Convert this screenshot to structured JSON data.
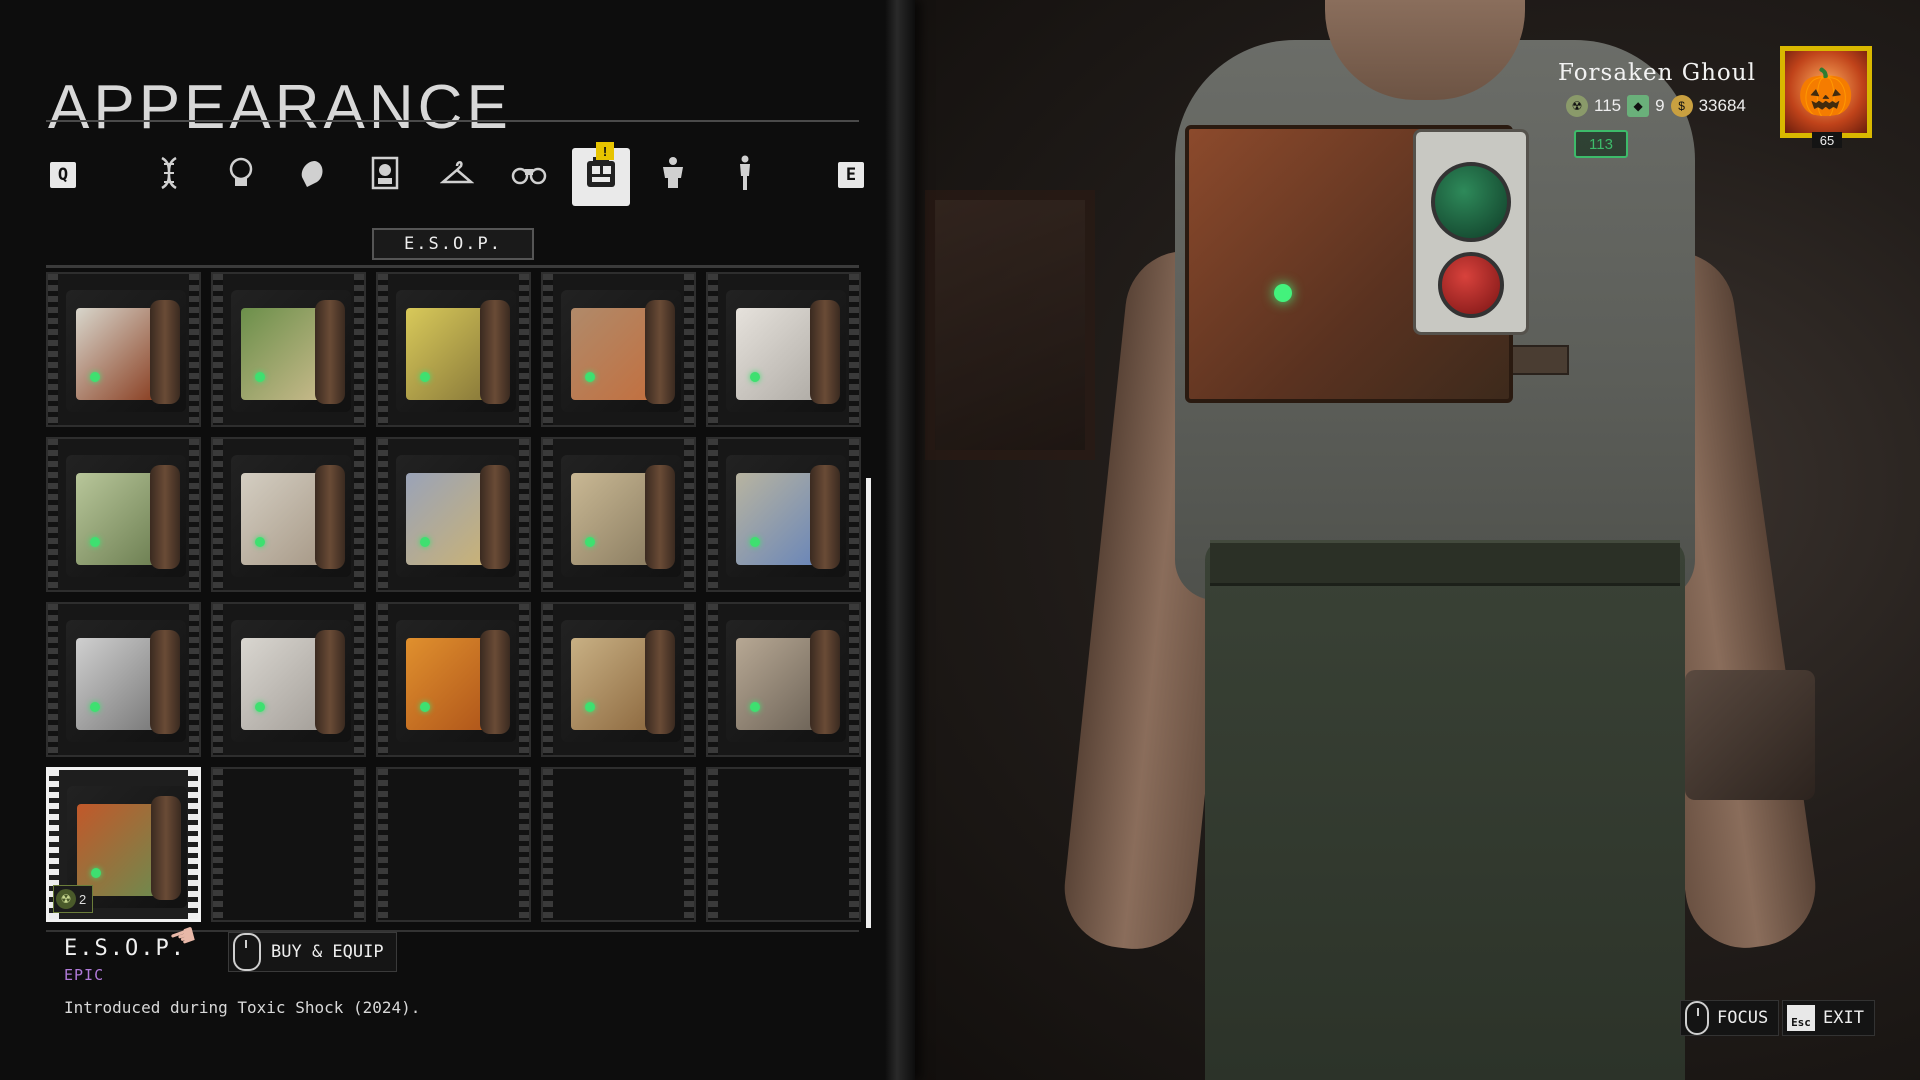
{
  "page": {
    "title": "APPEARANCE"
  },
  "tabs": {
    "prev_key": "Q",
    "next_key": "E",
    "items": [
      {
        "icon": "dna-icon"
      },
      {
        "icon": "head-icon"
      },
      {
        "icon": "profile-icon"
      },
      {
        "icon": "portrait-icon"
      },
      {
        "icon": "hanger-icon"
      },
      {
        "icon": "binoculars-icon"
      },
      {
        "icon": "backpack-icon",
        "active": true
      },
      {
        "icon": "torso-icon",
        "notification": "!"
      },
      {
        "icon": "body-icon"
      }
    ]
  },
  "category": {
    "label": "E.S.O.P."
  },
  "grid": {
    "items": [
      {
        "colors": [
          "#d8d6cc",
          "#8a3f22"
        ]
      },
      {
        "colors": [
          "#6b8f4a",
          "#c7b98a"
        ]
      },
      {
        "colors": [
          "#d8c95a",
          "#8a7a3a"
        ]
      },
      {
        "colors": [
          "#b08a6a",
          "#c27040"
        ]
      },
      {
        "colors": [
          "#e6e2dc",
          "#b0aca6"
        ]
      },
      {
        "colors": [
          "#b8c69a",
          "#6d7f52"
        ]
      },
      {
        "colors": [
          "#d4cec2",
          "#a89a88"
        ]
      },
      {
        "colors": [
          "#9aa3b8",
          "#c9b276"
        ]
      },
      {
        "colors": [
          "#c9b894",
          "#8c7e62"
        ]
      },
      {
        "colors": [
          "#b8b4a0",
          "#6a86b8"
        ]
      },
      {
        "colors": [
          "#cfcfcf",
          "#7a7a7a"
        ]
      },
      {
        "colors": [
          "#d9d6d0",
          "#a5a09a"
        ]
      },
      {
        "colors": [
          "#e0902e",
          "#b0561a"
        ]
      },
      {
        "colors": [
          "#c8b084",
          "#8e6a40"
        ]
      },
      {
        "colors": [
          "#b7a894",
          "#6e6458"
        ]
      },
      {
        "colors": [
          "#c2582a",
          "#6f8a4e"
        ],
        "selected": true,
        "owned_count": "2"
      },
      {
        "empty": true
      },
      {
        "empty": true
      },
      {
        "empty": true
      },
      {
        "empty": true
      }
    ]
  },
  "selected_item": {
    "name": "E.S.O.P.",
    "rarity": "EPIC",
    "description": "Introduced during Toxic Shock (2024).",
    "buy_label": "BUY & EQUIP"
  },
  "player": {
    "name": "Forsaken Ghoul",
    "currency_a": "115",
    "currency_b": "9",
    "currency_c": "33684",
    "level_chip": "113",
    "avatar_level": "65"
  },
  "controls": {
    "focus_label": "FOCUS",
    "exit_key": "Esc",
    "exit_label": "EXIT"
  },
  "colors": {
    "rarity_epic": "#b07ad8",
    "accent_gold": "#d9b800",
    "level_green": "#3dbb6a"
  }
}
